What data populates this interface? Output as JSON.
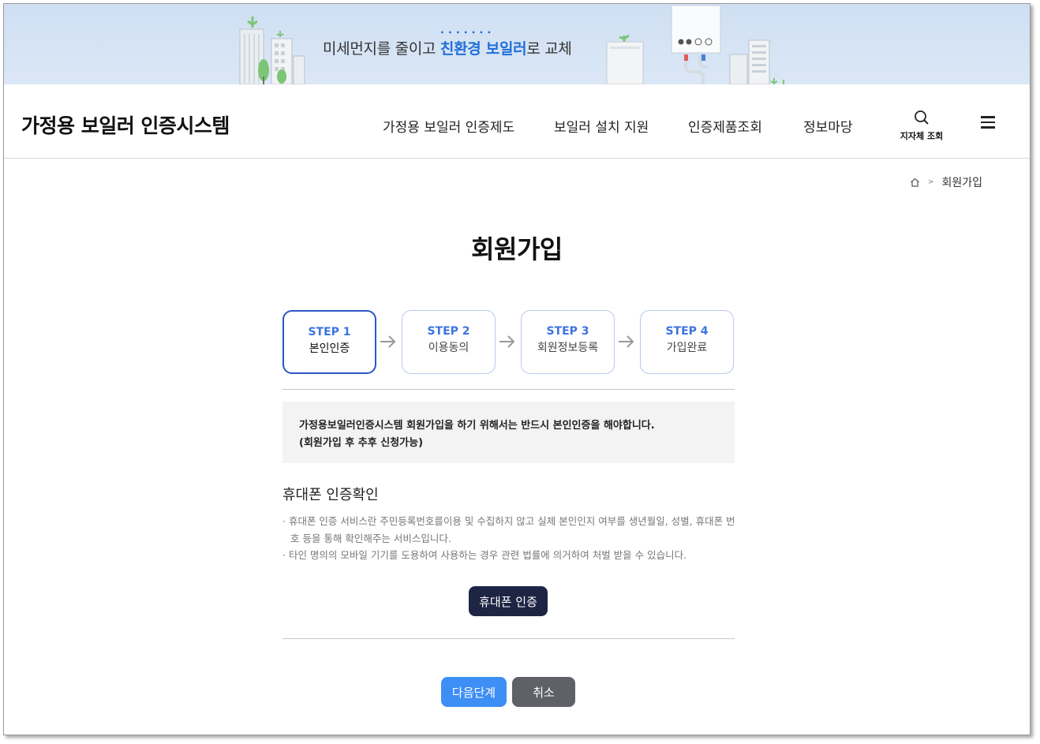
{
  "banner": {
    "text_before": "미세먼지를 줄이고 ",
    "text_highlight": "친환경 보일러",
    "text_after": "로 교체"
  },
  "header": {
    "site_title": "가정용 보일러 인증시스템",
    "nav": [
      {
        "label": "가정용 보일러 인증제도"
      },
      {
        "label": "보일러 설치 지원"
      },
      {
        "label": "인증제품조회"
      },
      {
        "label": "정보마당"
      }
    ],
    "search_label": "지자체 조회",
    "search_icon": "search-icon",
    "menu_icon": "hamburger-menu-icon"
  },
  "breadcrumb": {
    "home_icon": "home-icon",
    "current": "회원가입"
  },
  "page_title": "회원가입",
  "steps": [
    {
      "no": "STEP 1",
      "label": "본인인증",
      "active": true
    },
    {
      "no": "STEP 2",
      "label": "이용동의",
      "active": false
    },
    {
      "no": "STEP 3",
      "label": "회원정보등록",
      "active": false
    },
    {
      "no": "STEP 4",
      "label": "가입완료",
      "active": false
    }
  ],
  "notice": {
    "line1": "가정용보일러인증시스템 회원가입을 하기 위해서는 반드시 본인인증을 해야합니다.",
    "line2": "(회원가입 후 추후 신청가능)"
  },
  "phone_section": {
    "title": "휴대폰 인증확인",
    "bullets": [
      "휴대폰 인증 서비스란 주민등록번호를이용 및 수집하지 않고 실제 본인인지 여부를 생년월일, 성별, 휴대폰 번호 등을 통해 확인해주는 서비스입니다.",
      "타인 명의의 모바일 기기를 도용하여 사용하는 경우 관련 법률에 의거하여 처벌 받을 수 있습니다."
    ],
    "button": "휴대폰 인증"
  },
  "actions": {
    "next": "다음단계",
    "cancel": "취소"
  },
  "colors": {
    "accent": "#3d8ef5",
    "step_active_border": "#2b56c4",
    "step_text": "#3b73e0",
    "dark_button": "#1e2544",
    "cancel_button": "#5f6068",
    "banner_bg": "#d4e3f5"
  }
}
